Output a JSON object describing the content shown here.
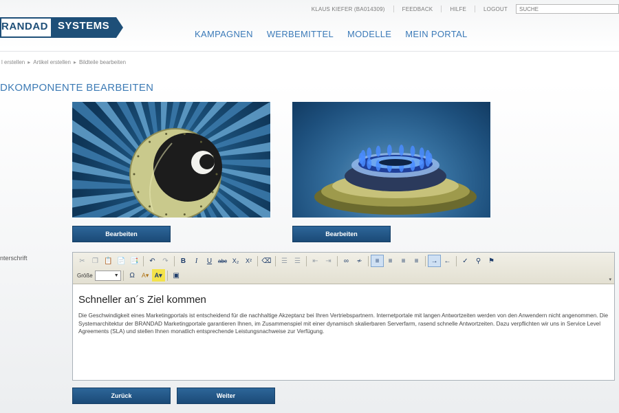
{
  "util": {
    "user": "KLAUS KIEFER (BA014309)",
    "feedback": "FEEDBACK",
    "help": "HILFE",
    "logout": "LOGOUT",
    "search_placeholder": "SUCHE"
  },
  "logo": {
    "left": "RANDAD",
    "right": "SYSTEMS"
  },
  "nav": {
    "items": [
      {
        "label": "KAMPAGNEN"
      },
      {
        "label": "WERBEMITTEL"
      },
      {
        "label": "MODELLE"
      },
      {
        "label": "MEIN PORTAL"
      }
    ]
  },
  "breadcrumb": {
    "items": [
      "l erstellen",
      "Artikel erstellen",
      "Bildteile bearbeiten"
    ]
  },
  "page_title": "DKOMPONENTE BEARBEITEN",
  "images": {
    "edit_label_1": "Bearbeiten",
    "edit_label_2": "Bearbeiten"
  },
  "field_label": "nterschrift",
  "toolbar": {
    "size_label": "Größe"
  },
  "editor": {
    "heading": "Schneller an´s Ziel kommen",
    "body": "Die Geschwindigkeit eines Marketingportals ist entscheidend für die nachhaltige Akzeptanz bei Ihren Vertriebspartnern. Internetportale mit langen Antwortzeiten werden von den Anwendern nicht angenommen. Die Systemarchitektur der BRANDAD Marketingportale garantieren Ihnen, im Zusammenspiel mit einer dynamisch skalierbaren Serverfarm, rasend schnelle Antwortzeiten. Dazu verpflichten wir uns in Service Level Agreements (SLA) und stellen Ihnen monatlich entsprechende Leistungsnachweise zur Verfügung."
  },
  "buttons": {
    "back": "Zurück",
    "next": "Weiter"
  },
  "colors": {
    "brand": "#1e4f78",
    "nav": "#3b7ab8",
    "title": "#3d7bb5"
  }
}
